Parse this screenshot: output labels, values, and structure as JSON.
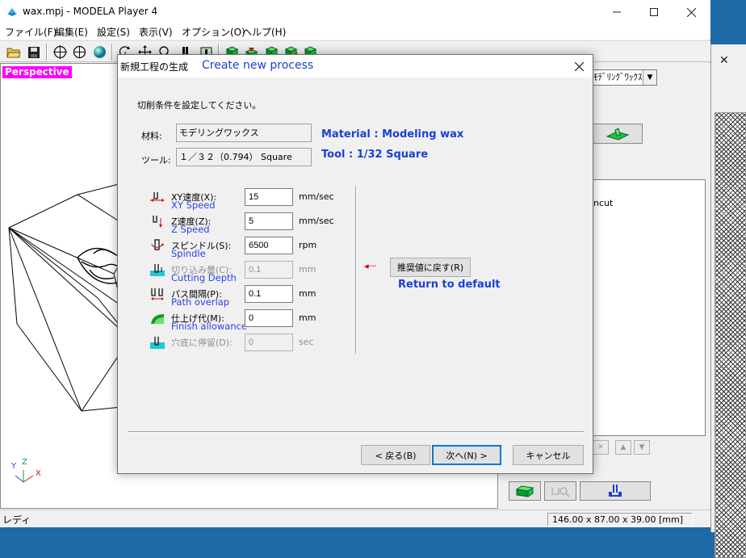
{
  "window": {
    "title": "wax.mpj - MODELA Player 4",
    "menu": [
      "ファイル(F)",
      "編集(E)",
      "設定(S)",
      "表示(V)",
      "オプション(O)",
      "ヘルプ(H)"
    ]
  },
  "viewport": {
    "label": "Perspective",
    "axes": {
      "x": "X",
      "y": "Y",
      "z": "Z"
    }
  },
  "right_panel": {
    "select_value": "ﾓﾃﾞﾘﾝｸﾞﾜｯｸｽ",
    "list_item": "ncut"
  },
  "status": {
    "text": "レディ",
    "size": "146.00 x 87.00 x 39.00 [mm]"
  },
  "dialog": {
    "title_jp": "新規工程の生成",
    "title_en": "Create new process",
    "instruction": "切削条件を設定してください。",
    "material": {
      "label": "材料:",
      "value": "モデリングワックス",
      "en": "Material : Modeling wax"
    },
    "tool": {
      "label": "ツール:",
      "value": "１／３２（0.794） Square",
      "en": "Tool : 1/32 Square"
    },
    "params": [
      {
        "label": "XY速度(X):",
        "en": "XY Speed",
        "value": "15",
        "unit": "mm/sec",
        "enabled": true
      },
      {
        "label": "Z速度(Z):",
        "en": "Z Speed",
        "value": "5",
        "unit": "mm/sec",
        "enabled": true
      },
      {
        "label": "スピンドル(S):",
        "en": "Spindle",
        "value": "6500",
        "unit": "rpm",
        "enabled": true
      },
      {
        "label": "切り込み量(C):",
        "en": "Cutting Depth",
        "value": "0.1",
        "unit": "mm",
        "enabled": false
      },
      {
        "label": "パス間隔(P):",
        "en": "Path overlap",
        "value": "0.1",
        "unit": "mm",
        "enabled": true
      },
      {
        "label": "仕上げ代(M):",
        "en": "Finish allowance",
        "value": "0",
        "unit": "mm",
        "enabled": true
      },
      {
        "label": "穴底に停留(D):",
        "en": "",
        "value": "0",
        "unit": "sec",
        "enabled": false
      }
    ],
    "default_button": "推奨値に戻す(R)",
    "default_en": "Return to default",
    "buttons": {
      "back": "< 戻る(B)",
      "next": "次へ(N) >",
      "cancel": "キャンセル"
    }
  },
  "colors": {
    "accent_blue": "#1a3fd6",
    "label_blue": "#2a44e8",
    "perspective_bg": "#ff00ff",
    "arrow_red": "#cc0000"
  }
}
